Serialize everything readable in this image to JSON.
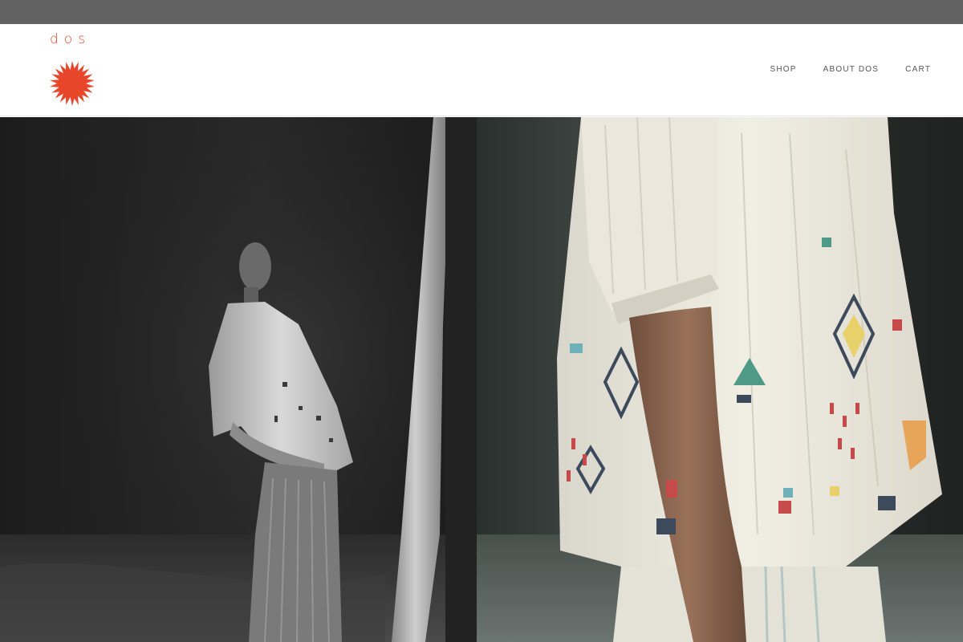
{
  "brand": {
    "wordmark": "dos",
    "accent_color": "#e8462a",
    "logo_icon": "sun-icon"
  },
  "nav": {
    "items": [
      {
        "label": "SHOP"
      },
      {
        "label": "ABOUT DOS"
      },
      {
        "label": "CART"
      }
    ]
  },
  "hero": {
    "images": [
      {
        "subject": "black-and-white photo of a model in an embroidered white blouse and striped trousers"
      },
      {
        "subject": "colour close-up of an embroidered cream blouse with geometric motifs"
      }
    ]
  },
  "colors": {
    "top_bar": "#626262",
    "nav_text": "#555555"
  }
}
